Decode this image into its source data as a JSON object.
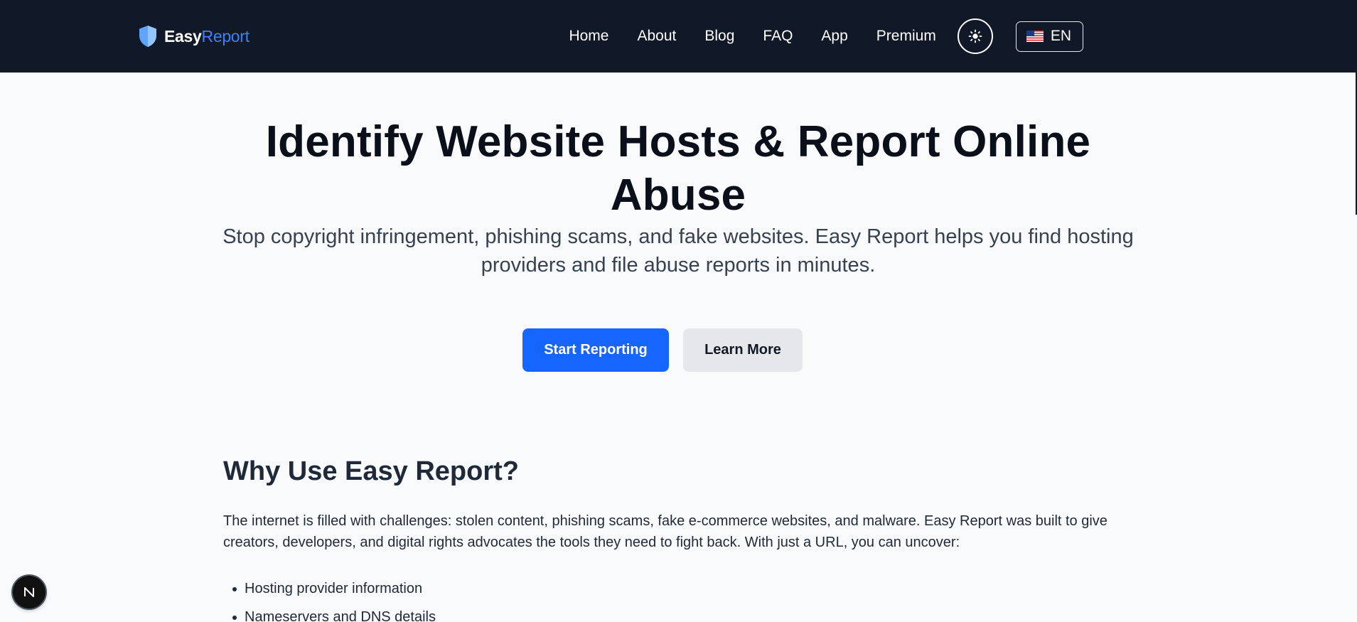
{
  "header": {
    "logo": {
      "easy": "Easy",
      "report": "Report"
    },
    "nav": [
      "Home",
      "About",
      "Blog",
      "FAQ",
      "App",
      "Premium"
    ],
    "theme_icon": "sun-icon",
    "language": {
      "flag": "us-flag-icon",
      "code": "EN"
    }
  },
  "hero": {
    "title": "Identify Website Hosts & Report Online Abuse",
    "subtitle": "Stop copyright infringement, phishing scams, and fake websites. Easy Report helps you find hosting providers and file abuse reports in minutes.",
    "primary_cta": "Start Reporting",
    "secondary_cta": "Learn More"
  },
  "why": {
    "heading": "Why Use Easy Report?",
    "body": "The internet is filled with challenges: stolen content, phishing scams, fake e-commerce websites, and malware. Easy Report was built to give creators, developers, and digital rights advocates the tools they need to fight back. With just a URL, you can uncover:",
    "items": [
      "Hosting provider information",
      "Nameservers and DNS details"
    ]
  },
  "dev_badge": {
    "letter": "N"
  },
  "colors": {
    "header_bg": "#111827",
    "accent": "#1565ff",
    "logo_blue": "#3b82f6",
    "page_bg": "#f8fafc"
  }
}
